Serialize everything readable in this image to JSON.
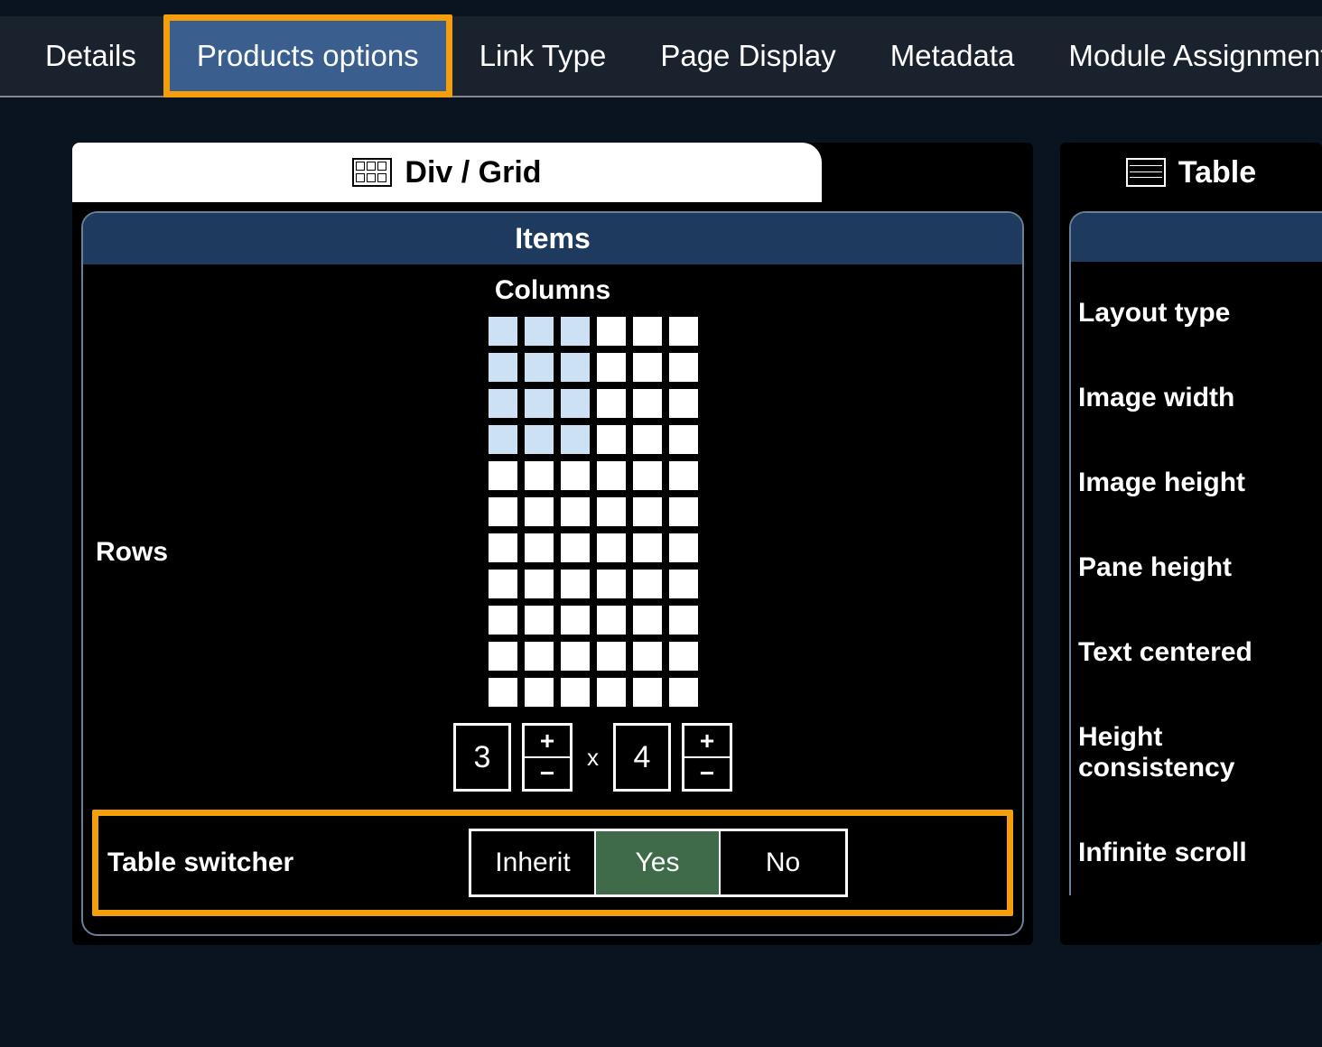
{
  "tabs": {
    "details": "Details",
    "products_options": "Products options",
    "link_type": "Link Type",
    "page_display": "Page Display",
    "metadata": "Metadata",
    "module_assignment": "Module Assignment"
  },
  "panel_tabs": {
    "div_grid": "Div / Grid",
    "table": "Table"
  },
  "left": {
    "items_header": "Items",
    "columns_label": "Columns",
    "rows_label": "Rows",
    "grid": {
      "total_cols": 6,
      "total_rows": 11,
      "selected_cols": 3,
      "selected_rows": 4
    },
    "stepper": {
      "value_a": "3",
      "value_b": "4",
      "plus": "+",
      "minus": "−",
      "x": "x"
    },
    "switcher": {
      "label": "Table switcher",
      "options": {
        "inherit": "Inherit",
        "yes": "Yes",
        "no": "No"
      },
      "selected": "yes"
    }
  },
  "right": {
    "layout_type": "Layout type",
    "image_width": "Image width",
    "image_height": "Image height",
    "pane_height": "Pane height",
    "text_centered": "Text centered",
    "height_consistency": "Height consistency",
    "infinite_scroll": "Infinite scroll"
  }
}
